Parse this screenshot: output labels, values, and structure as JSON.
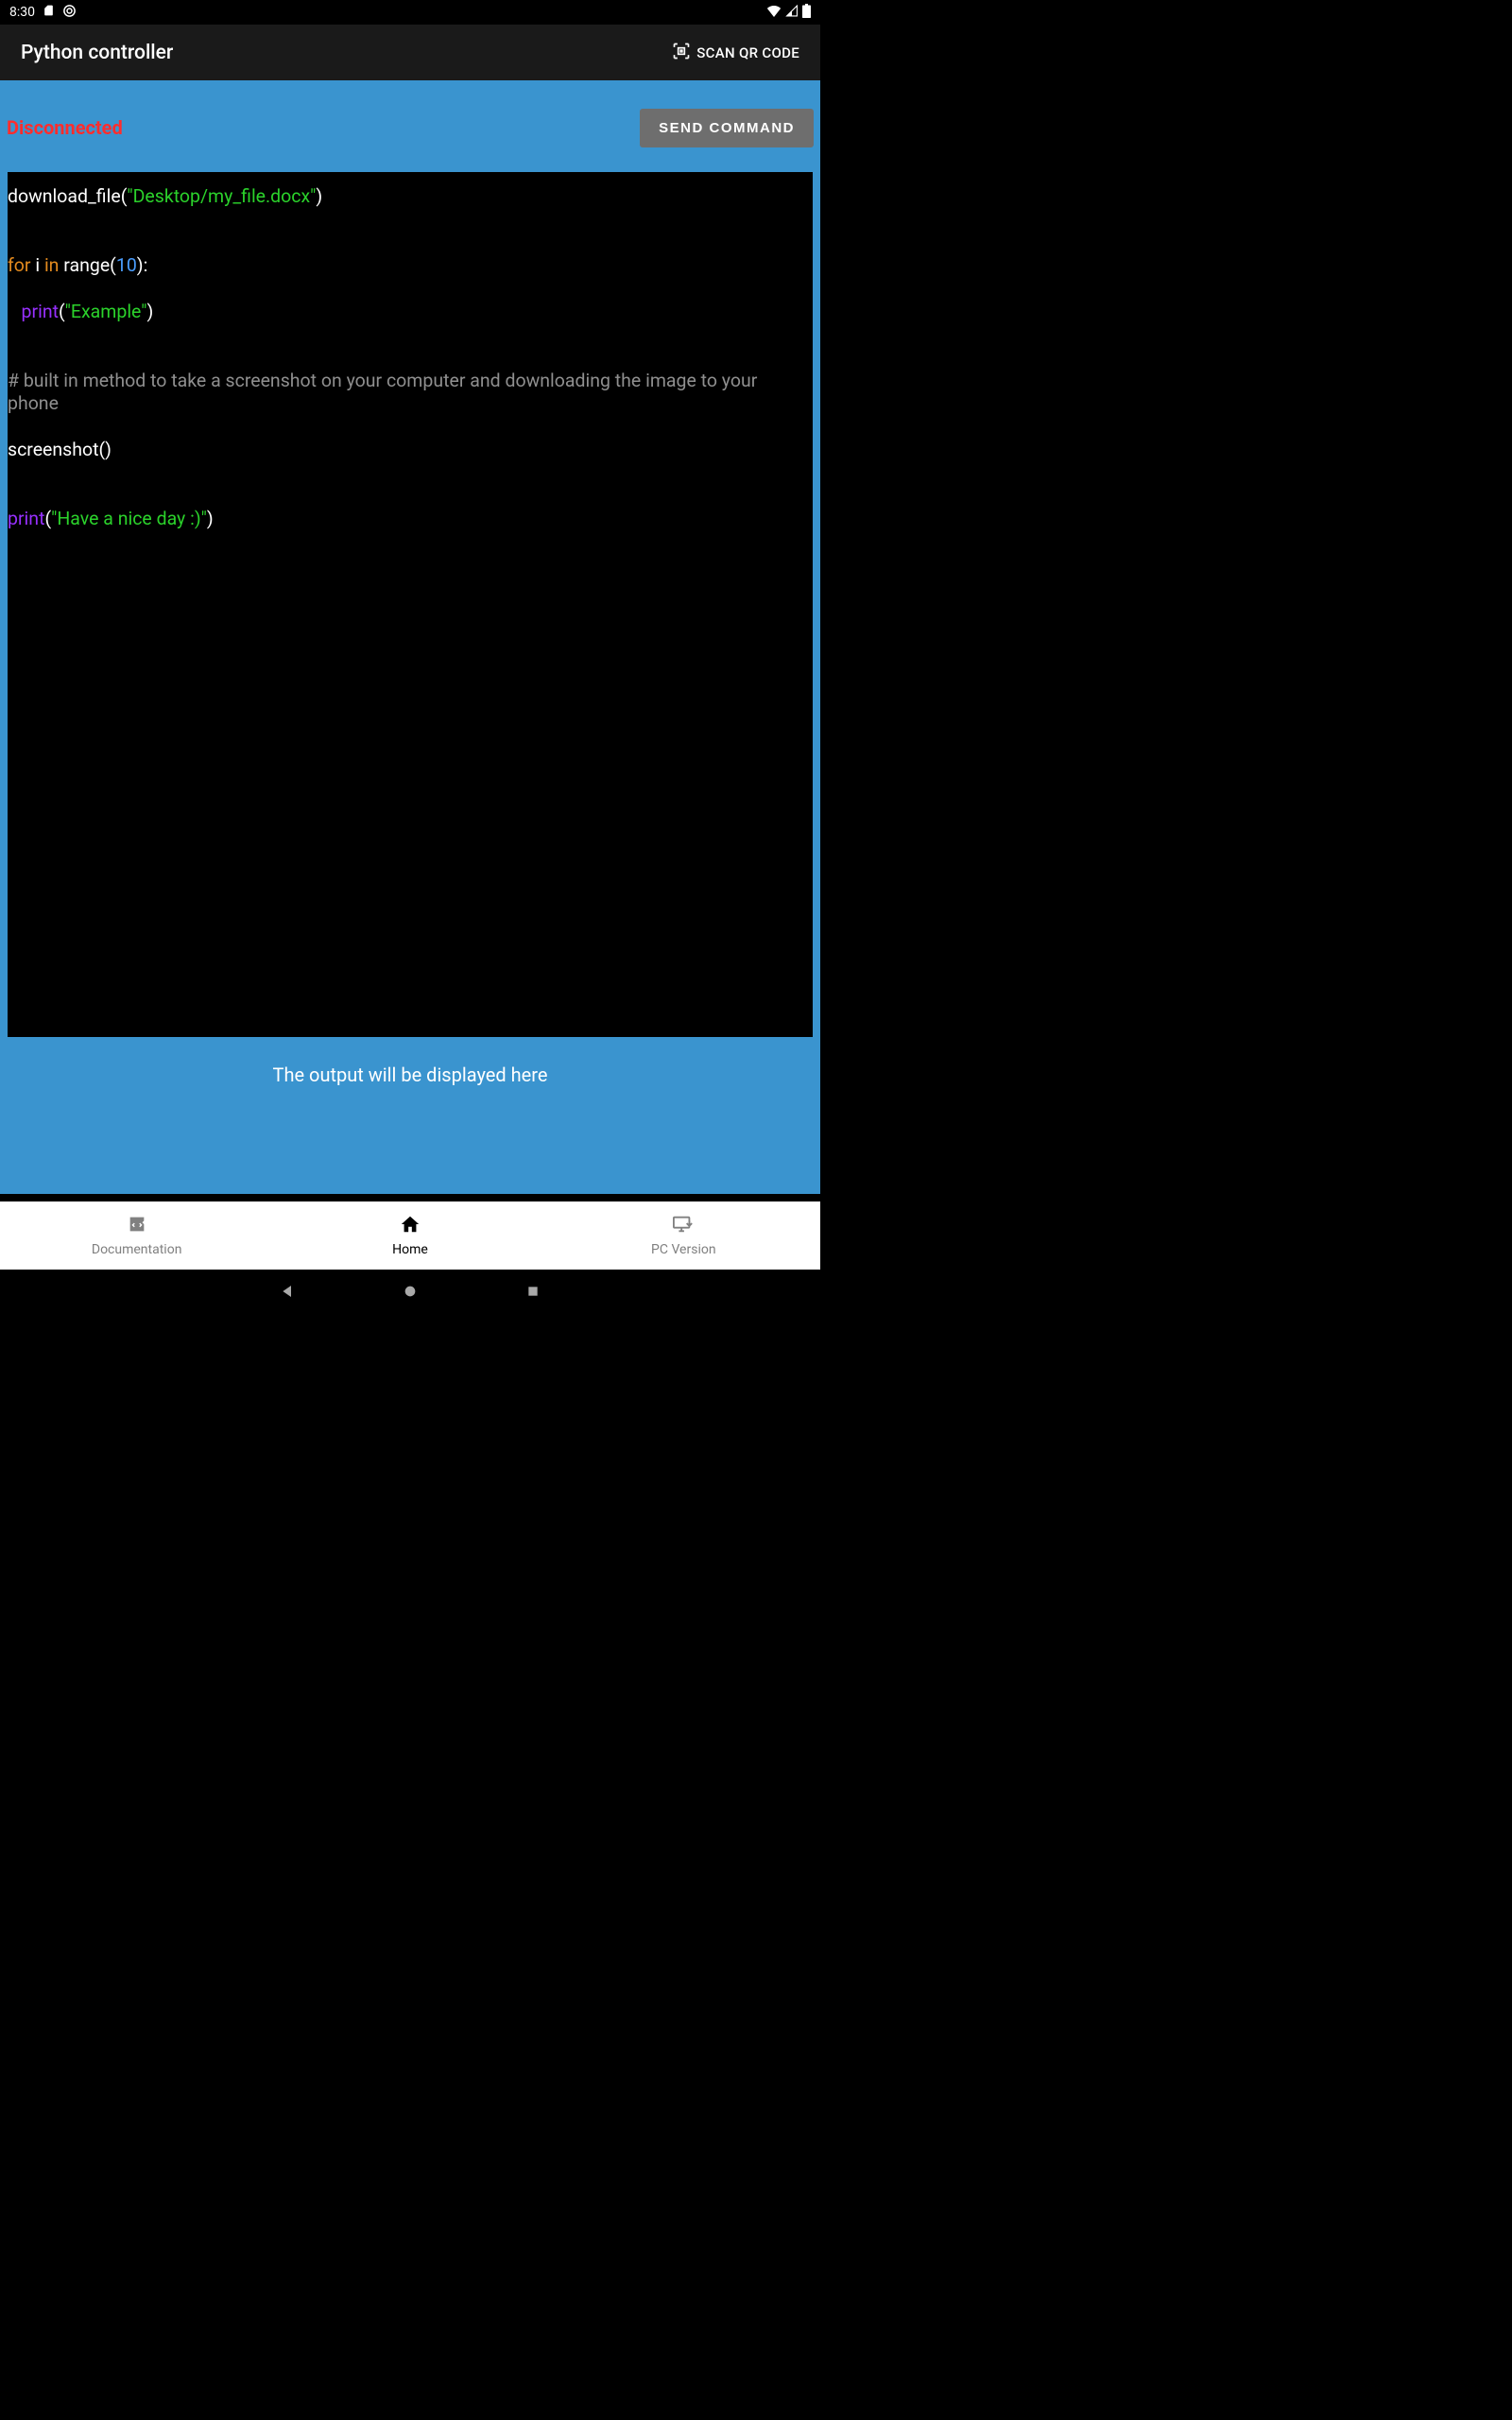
{
  "status_bar": {
    "time": "8:30"
  },
  "app_bar": {
    "title": "Python controller",
    "scan_label": "SCAN QR CODE"
  },
  "connection_status": "Disconnected",
  "send_button_label": "SEND COMMAND",
  "code": {
    "l1_fn": "download_file(",
    "l1_str": "\"Desktop/my_file.docx\"",
    "l1_close": ")",
    "l3_for": "for",
    "l3_i": " i ",
    "l3_in": "in",
    "l3_range": " range(",
    "l3_num": "10",
    "l3_close": "):",
    "l4_indent": "   ",
    "l4_print": "print",
    "l4_open": "(",
    "l4_str": "\"Example\"",
    "l4_close": ")",
    "l6_comment": "# built in method to take a screenshot on your computer and downloading the image to your\nphone",
    "l7_call": "screenshot()",
    "l9_print": "print",
    "l9_open": "(",
    "l9_str": "\"Have a nice day :)\"",
    "l9_close": ")"
  },
  "output_hint": "The output will be displayed here",
  "nav": {
    "doc": "Documentation",
    "home": "Home",
    "pc": "PC Version"
  }
}
